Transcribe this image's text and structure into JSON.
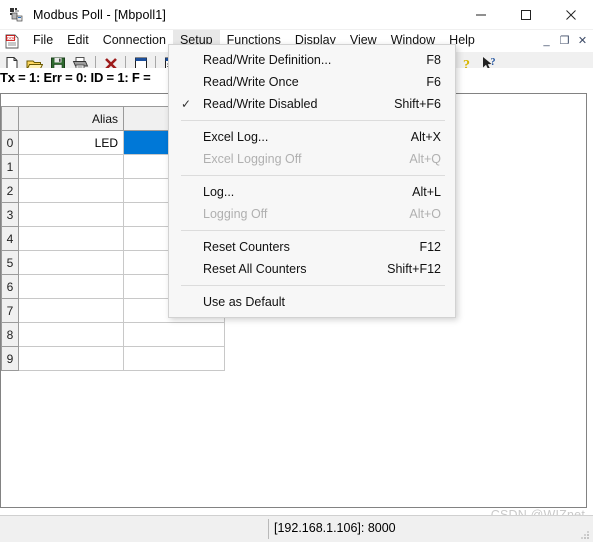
{
  "window": {
    "title": "Modbus Poll - [Mbpoll1]",
    "app_icon": "modbus-poll-icon",
    "minimize_label": "─",
    "maximize_label": "□",
    "close_label": "✕"
  },
  "menubar": {
    "doc_icon": "document-icon",
    "items": [
      {
        "label": "File",
        "active": false
      },
      {
        "label": "Edit",
        "active": false
      },
      {
        "label": "Connection",
        "active": false
      },
      {
        "label": "Setup",
        "active": true
      },
      {
        "label": "Functions",
        "active": false
      },
      {
        "label": "Display",
        "active": false
      },
      {
        "label": "View",
        "active": false
      },
      {
        "label": "Window",
        "active": false
      },
      {
        "label": "Help",
        "active": false
      }
    ],
    "mdi_buttons": [
      {
        "name": "mdi-minimize-button",
        "label": "_"
      },
      {
        "name": "mdi-restore-button",
        "label": "❐"
      },
      {
        "name": "mdi-close-button",
        "label": "✕"
      }
    ]
  },
  "toolbar": {
    "buttons": [
      {
        "name": "new-file-button",
        "icon": "new-document-icon"
      },
      {
        "name": "open-file-button",
        "icon": "open-folder-icon"
      },
      {
        "name": "save-file-button",
        "icon": "floppy-disk-icon"
      },
      {
        "name": "print-button",
        "icon": "printer-icon"
      },
      {
        "name": "disconnect-button",
        "icon": "red-x-icon"
      },
      {
        "name": "read-write-def-button",
        "icon": "window-properties-icon"
      },
      {
        "name": "poll-definition-button",
        "icon": "poll-icon"
      }
    ],
    "right_buttons": [
      {
        "name": "help-button",
        "icon": "question-mark-icon"
      },
      {
        "name": "context-help-button",
        "icon": "arrow-question-icon"
      }
    ]
  },
  "dropdown": {
    "name": "setup-menu",
    "items": [
      {
        "type": "item",
        "label": "Read/Write Definition...",
        "accel": "F8",
        "checked": false,
        "disabled": false
      },
      {
        "type": "item",
        "label": "Read/Write Once",
        "accel": "F6",
        "checked": false,
        "disabled": false
      },
      {
        "type": "item",
        "label": "Read/Write Disabled",
        "accel": "Shift+F6",
        "checked": true,
        "disabled": false
      },
      {
        "type": "separator"
      },
      {
        "type": "item",
        "label": "Excel Log...",
        "accel": "Alt+X",
        "checked": false,
        "disabled": false
      },
      {
        "type": "item",
        "label": "Excel Logging Off",
        "accel": "Alt+Q",
        "checked": false,
        "disabled": true
      },
      {
        "type": "separator"
      },
      {
        "type": "item",
        "label": "Log...",
        "accel": "Alt+L",
        "checked": false,
        "disabled": false
      },
      {
        "type": "item",
        "label": "Logging Off",
        "accel": "Alt+O",
        "checked": false,
        "disabled": true
      },
      {
        "type": "separator"
      },
      {
        "type": "item",
        "label": "Reset Counters",
        "accel": "F12",
        "checked": false,
        "disabled": false
      },
      {
        "type": "item",
        "label": "Reset All Counters",
        "accel": "Shift+F12",
        "checked": false,
        "disabled": false
      },
      {
        "type": "separator"
      },
      {
        "type": "item",
        "label": "Use as Default",
        "accel": "",
        "checked": false,
        "disabled": false
      }
    ],
    "check_glyph": "✓"
  },
  "child_window": {
    "status_line": "Tx = 1: Err = 0: ID = 1: F =",
    "grid": {
      "corner_label": "",
      "columns": [
        {
          "key": "alias",
          "label": "Alias"
        },
        {
          "key": "value",
          "label": ""
        }
      ],
      "rows": [
        {
          "index": "0",
          "alias": "LED",
          "value": "",
          "selected": true
        },
        {
          "index": "1",
          "alias": "",
          "value": "",
          "selected": false
        },
        {
          "index": "2",
          "alias": "",
          "value": "",
          "selected": false
        },
        {
          "index": "3",
          "alias": "",
          "value": "",
          "selected": false
        },
        {
          "index": "4",
          "alias": "",
          "value": "",
          "selected": false
        },
        {
          "index": "5",
          "alias": "",
          "value": "",
          "selected": false
        },
        {
          "index": "6",
          "alias": "",
          "value": "",
          "selected": false
        },
        {
          "index": "7",
          "alias": "",
          "value": "",
          "selected": false
        },
        {
          "index": "8",
          "alias": "",
          "value": "",
          "selected": false
        },
        {
          "index": "9",
          "alias": "",
          "value": "",
          "selected": false
        }
      ],
      "selection_color": "#0078d7"
    }
  },
  "statusbar": {
    "left_text": "",
    "connection_text": "[192.168.1.106]: 8000"
  },
  "watermark": "CSDN @WIZnet"
}
